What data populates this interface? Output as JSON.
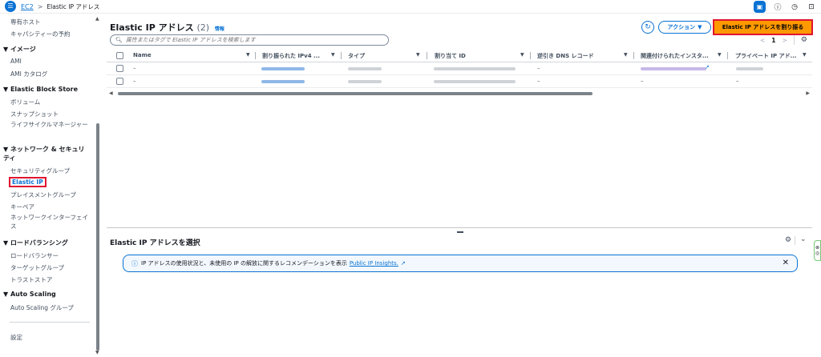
{
  "topbar": {
    "breadcrumb": [
      "EC2",
      "Elastic IP アドレス"
    ],
    "breadcrumb_sep": ">",
    "icons": [
      "panel-icon",
      "info-icon",
      "history-icon",
      "feedback-icon"
    ]
  },
  "sidebar": {
    "items": [
      {
        "type": "item",
        "label": "専有ホスト"
      },
      {
        "type": "item",
        "label": "キャパシティーの予約"
      },
      {
        "type": "head",
        "label": "▼ イメージ"
      },
      {
        "type": "item",
        "label": "AMI"
      },
      {
        "type": "item",
        "label": "AMI カタログ"
      },
      {
        "type": "head",
        "label": "▼ Elastic Block Store"
      },
      {
        "type": "item",
        "label": "ボリューム"
      },
      {
        "type": "item",
        "label": "スナップショット"
      },
      {
        "type": "item",
        "label": "ライフサイクルマネージャー"
      },
      {
        "type": "head",
        "label": "▼ ネットワーク & セキュリティ"
      },
      {
        "type": "item",
        "label": "セキュリティグループ"
      },
      {
        "type": "active",
        "label": "Elastic IP"
      },
      {
        "type": "item",
        "label": "プレイスメントグループ"
      },
      {
        "type": "item",
        "label": "キーペア"
      },
      {
        "type": "item",
        "label": "ネットワークインターフェイス"
      },
      {
        "type": "head",
        "label": "▼ ロードバランシング"
      },
      {
        "type": "item",
        "label": "ロードバランサー"
      },
      {
        "type": "item",
        "label": "ターゲットグループ"
      },
      {
        "type": "item",
        "label": "トラストストア"
      },
      {
        "type": "head",
        "label": "▼ Auto Scaling"
      },
      {
        "type": "item",
        "label": "Auto Scaling グループ"
      },
      {
        "type": "item",
        "label": "設定"
      }
    ]
  },
  "main": {
    "title": "Elastic IP アドレス",
    "count": "(2)",
    "info_link": "情報",
    "actions_label": "アクション",
    "allocate_label": "Elastic IP アドレスを割り振る",
    "search_placeholder": "属性またはタグで Elastic IP アドレスを検索します",
    "pager": {
      "prev": "<",
      "page": "1",
      "next": ">"
    },
    "columns": [
      "Name",
      "割り振られた IPv4 ...",
      "タイプ",
      "割り当て ID",
      "逆引き DNS レコード",
      "関連付けられたインスタ...",
      "プライベート IP アド..."
    ],
    "rows": [
      {
        "name": "–",
        "dns": "–",
        "private_ip": ""
      },
      {
        "name": "–",
        "dns": "–",
        "associated": "–",
        "private_ip": "–"
      }
    ]
  },
  "lower": {
    "title": "Elastic IP アドレスを選択",
    "notice_text": "IP アドレスの使用状況と、未使用の IP の解放に関するレコメンデーションを表示",
    "notice_link": "Public IP Insights."
  },
  "colors": {
    "accent": "#0972d3",
    "primary_button": "#ff9900",
    "highlight": "#e0142f"
  }
}
